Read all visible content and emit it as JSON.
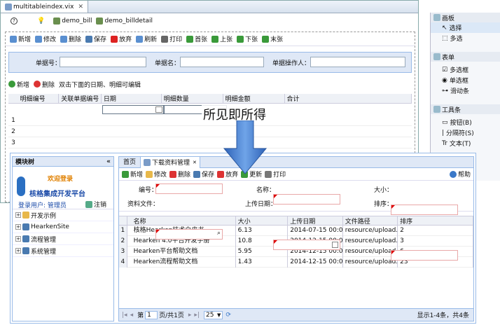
{
  "editor": {
    "tab_title": "multitableindex.vix",
    "toolbar": {
      "help": "?",
      "bill": "demo_bill",
      "billdetail": "demo_billdetail"
    },
    "bill_toolbar": [
      "新增",
      "修改",
      "删除",
      "保存",
      "放弃",
      "刷新",
      "打印",
      "首张",
      "上张",
      "下张",
      "末张"
    ],
    "form": {
      "billno": "单据号：",
      "billname": "单据名：",
      "operator": "单据操作人："
    },
    "detail_toolbar": {
      "add": "新增",
      "del": "删除",
      "hint": "双击下面的日期、明细可编辑"
    },
    "grid_headers": [
      "明细编号",
      "关联单据编号",
      "日期",
      "明细数量",
      "明细金额",
      "合计"
    ],
    "rows": [
      "1",
      "2",
      "3"
    ]
  },
  "palette": {
    "header": "画板",
    "items": [
      "选择",
      "多选"
    ],
    "form_header": "表单",
    "form_items": [
      "多选框",
      "单选框",
      "滑动条"
    ],
    "toolbar_header": "工具条",
    "toolbar_items": [
      "按钮(B)",
      "分隔符(S)",
      "文本(T)"
    ]
  },
  "overlay": {
    "text": "所见即所得"
  },
  "app": {
    "module_tree": "模块树",
    "logo_line1": "欢迎登录",
    "logo_line2": "核格集成开发平台",
    "user": "登录用户: 管理员",
    "logout": "注销",
    "tree": [
      "开发示例",
      "HearkenSite",
      "流程管理",
      "系统管理"
    ],
    "tabs": {
      "home": "首页",
      "active": "下载资料管理"
    },
    "toolbar": [
      "新增",
      "修改",
      "删除",
      "保存",
      "放弃",
      "更新",
      "打印"
    ],
    "help": "帮助",
    "form": {
      "code": "编号：",
      "name": "名称：",
      "size": "大小：",
      "file": "资料文件：",
      "date": "上传日期：",
      "order": "排序："
    },
    "headers": [
      "名称",
      "大小",
      "上传日期",
      "文件路径",
      "排序"
    ],
    "rows": [
      {
        "n": "1",
        "name": "核格Hearken技术白皮书",
        "size": "6.13",
        "date": "2014-07-15 00:0...",
        "path": "resource/upload...",
        "order": "2"
      },
      {
        "n": "2",
        "name": "Hearken 4.0平台开发手册",
        "size": "10.8",
        "date": "2014-12-15 00:0...",
        "path": "resource/upload...",
        "order": "3"
      },
      {
        "n": "3",
        "name": "Hearken平台帮助文档",
        "size": "5.95",
        "date": "2014-12-15 00:0...",
        "path": "resource/upload...",
        "order": "6"
      },
      {
        "n": "4",
        "name": "Hearken流程帮助文档",
        "size": "1.43",
        "date": "2014-12-15 00:0...",
        "path": "resource/upload...",
        "order": "23"
      }
    ],
    "pager": {
      "page": "第",
      "pagenum": "1",
      "pagetotal": "页/共1页",
      "pagesize": "25",
      "info": "显示1-4条，共4条"
    }
  },
  "colors": {
    "accent": "#3a78c8",
    "border": "#99bbe8",
    "header_bg": "#dfe8f6"
  }
}
